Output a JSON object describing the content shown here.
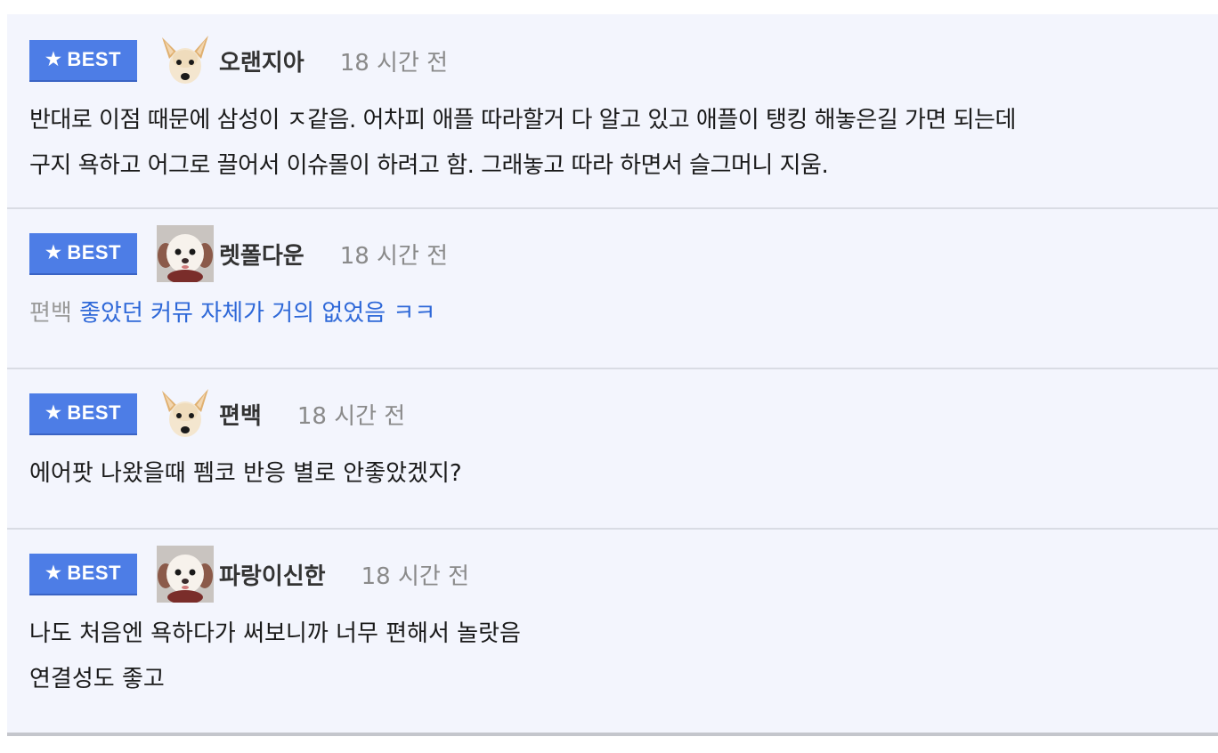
{
  "badge": {
    "label": "BEST",
    "icon": "star-icon",
    "color": "#4d7de6"
  },
  "comments": [
    {
      "avatar": "chihuahua-avatar",
      "nickname": "오랜지아",
      "time": "18 시간 전",
      "lines": [
        "반대로 이점 때문에 삼성이 ㅈ같음. 어차피 애플 따라할거 다 알고 있고 애플이 탱킹 해놓은길 가면 되는데",
        "구지 욕하고 어그로 끌어서 이슈몰이 하려고 함. 그래놓고 따라 하면서 슬그머니 지움."
      ]
    },
    {
      "avatar": "puppy-avatar",
      "nickname": "렛폴다운",
      "time": "18 시간 전",
      "reply_to": "편백",
      "text": "좋았던 커뮤 자체가 거의 없었음 ㅋㅋ"
    },
    {
      "avatar": "chihuahua-avatar",
      "nickname": "편백",
      "time": "18 시간 전",
      "lines": [
        "에어팟 나왔을때 펨코 반응 별로 안좋았겠지?"
      ]
    },
    {
      "avatar": "puppy-avatar",
      "nickname": "파랑이신한",
      "time": "18 시간 전",
      "lines": [
        "나도 처음엔 욕하다가 써보니까 너무 편해서 놀랏음",
        "연결성도 좋고"
      ]
    }
  ]
}
